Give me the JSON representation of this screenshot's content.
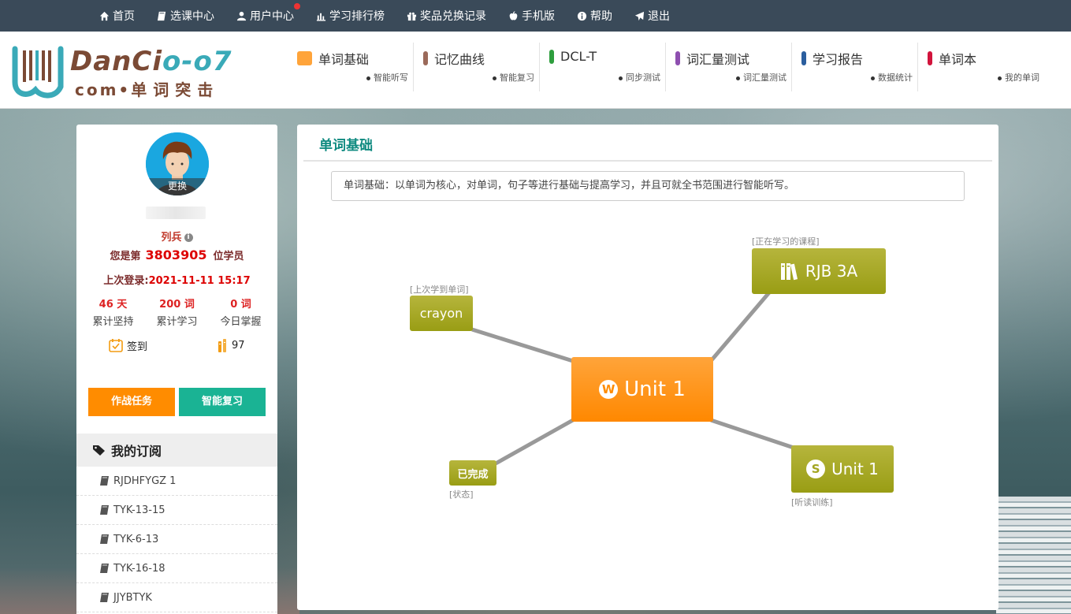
{
  "topbar": {
    "items": [
      {
        "label": "首页",
        "icon": "home-icon"
      },
      {
        "label": "选课中心",
        "icon": "book-icon"
      },
      {
        "label": "用户中心",
        "icon": "user-icon"
      },
      {
        "label": "学习排行榜",
        "icon": "bar-chart-icon"
      },
      {
        "label": "奖品兑换记录",
        "icon": "gift-icon"
      },
      {
        "label": "手机版",
        "icon": "apple-icon"
      },
      {
        "label": "帮助",
        "icon": "info-icon"
      },
      {
        "label": "退出",
        "icon": "paper-plane-icon"
      }
    ]
  },
  "logo": {
    "brand_a": "DanCi",
    "brand_b": "o-o7",
    "sub_a": "com•",
    "sub_b": "单词突击"
  },
  "menu": [
    {
      "label": "单词基础",
      "sub": "智能听写",
      "color": "#ffa43a"
    },
    {
      "label": "记忆曲线",
      "sub": "智能复习",
      "color": "#9b6a5a"
    },
    {
      "label": "DCL-T",
      "sub": "同步测试",
      "color": "#2e9e3e"
    },
    {
      "label": "词汇量测试",
      "sub": "词汇量测试",
      "color": "#8e4fb0"
    },
    {
      "label": "学习报告",
      "sub": "数据统计",
      "color": "#2b5e9e"
    },
    {
      "label": "单词本",
      "sub": "我的单词",
      "color": "#d2143c"
    }
  ],
  "profile": {
    "avatar_action": "更换",
    "rank": "列兵",
    "order_prefix": "您是第",
    "order_number": "3803905",
    "order_suffix": "位学员",
    "last_login_label": "上次登录:",
    "last_login_value": "2021-11-11 15:17",
    "stats": [
      {
        "value": "46 天",
        "label": "累计坚持"
      },
      {
        "value": "200 词",
        "label": "累计学习"
      },
      {
        "value": "0 词",
        "label": "今日掌握"
      }
    ],
    "checkin_label": "签到",
    "coins": "97",
    "task_button": "作战任务",
    "review_button": "智能复习"
  },
  "subscriptions": {
    "title": "我的订阅",
    "items": [
      "RJDHFYGZ 1",
      "TYK-13-15",
      "TYK-6-13",
      "TYK-16-18",
      "JJYBTYK"
    ]
  },
  "main": {
    "title": "单词基础",
    "description": "单词基础：以单词为核心，对单词，句子等进行基础与提高学习，并且可就全书范围进行智能听写。",
    "center_node": "Unit 1",
    "nodes": {
      "last_word": {
        "caption": "[上次学到单词]",
        "label": "crayon"
      },
      "current_course": {
        "caption": "[正在学习的课程]",
        "label": "RJB 3A"
      },
      "status": {
        "caption": "[状态]",
        "label": "已完成"
      },
      "listening": {
        "caption": "[听读训练]",
        "label": "Unit 1"
      }
    }
  }
}
